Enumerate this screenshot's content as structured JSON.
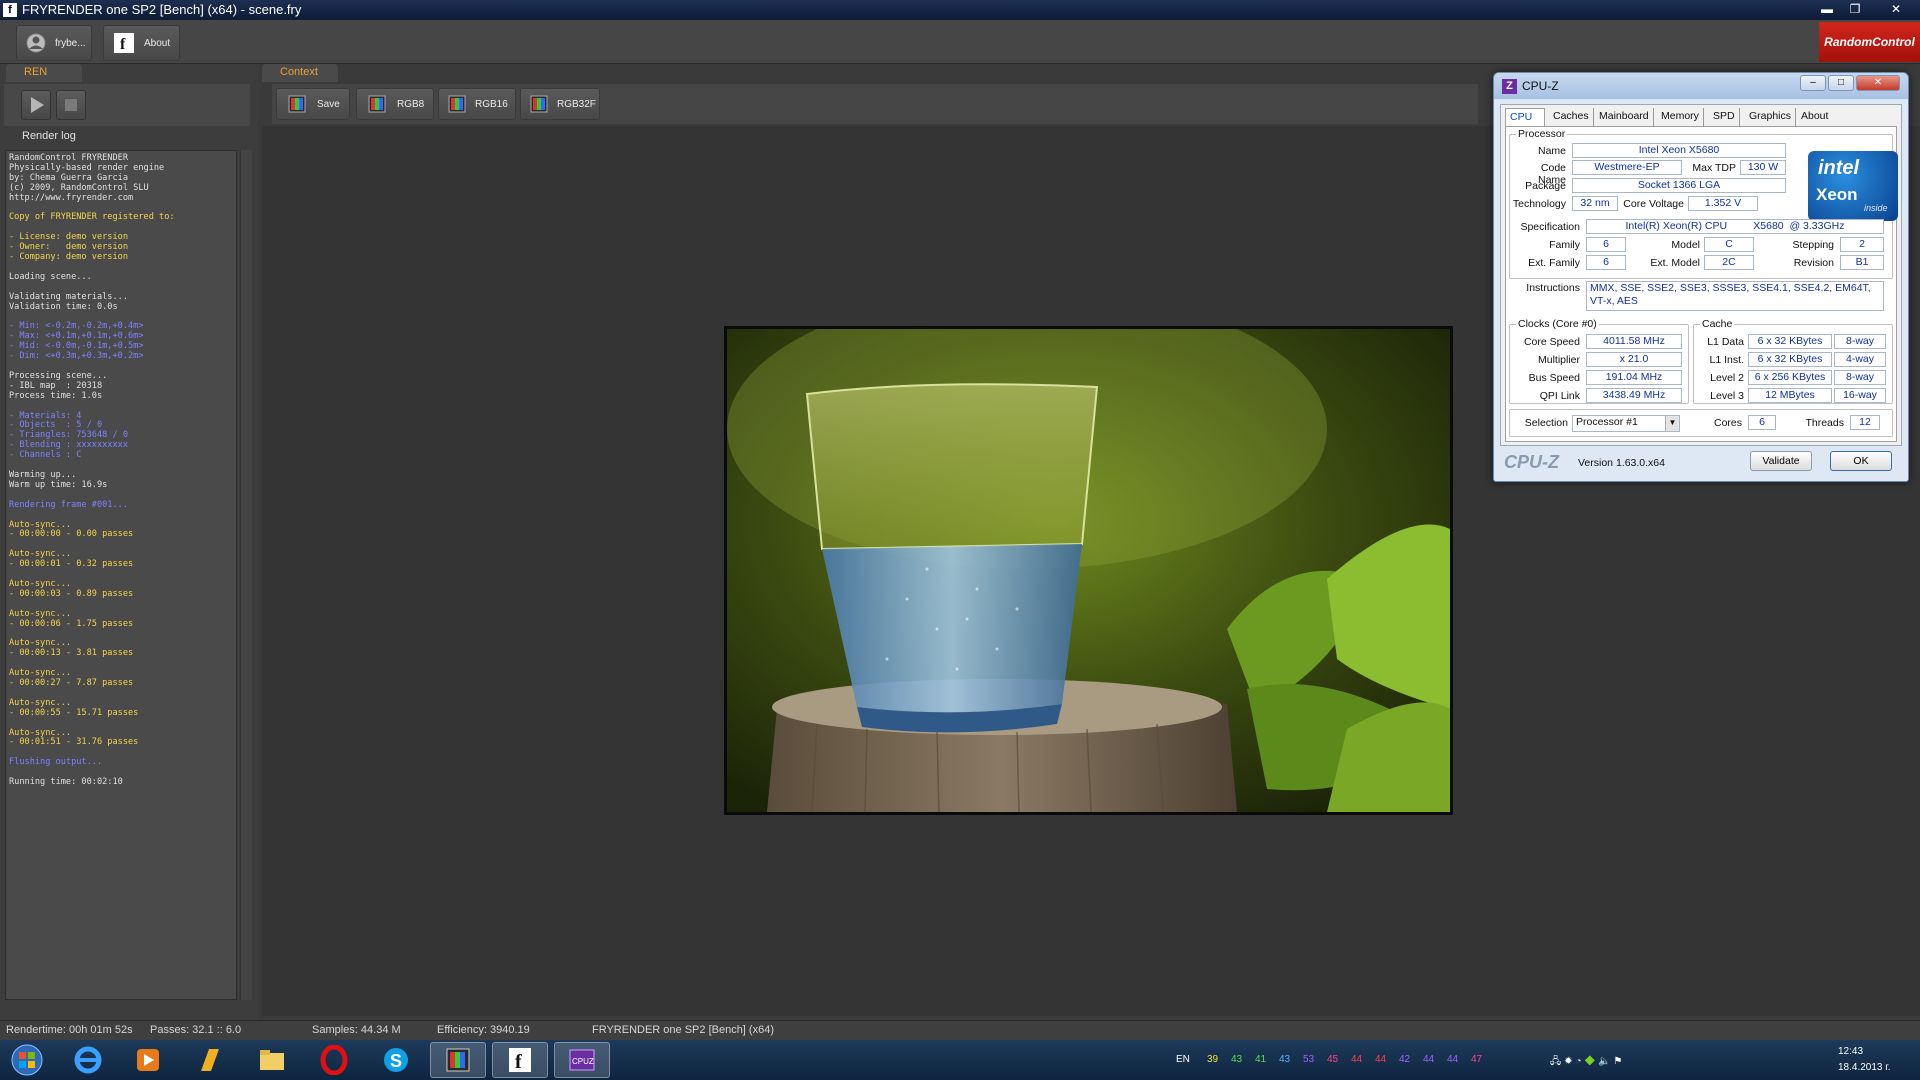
{
  "window": {
    "title": "FRYRENDER one SP2 [Bench] (x64) - scene.fry",
    "minimize": "▬",
    "maximize": "❐",
    "close": "✕"
  },
  "app_toolbar": {
    "frybe_label": "frybe...",
    "about_label": "About",
    "brand": "RandomControl"
  },
  "left_panel": {
    "tab": "REN",
    "log_title": "Render log",
    "log_lines": [
      {
        "c": "w",
        "t": "RandomControl FRYRENDER"
      },
      {
        "c": "w",
        "t": "Physically-based render engine"
      },
      {
        "c": "w",
        "t": "by: Chema Guerra Garcia"
      },
      {
        "c": "w",
        "t": "(c) 2009, RandomControl SLU"
      },
      {
        "c": "w",
        "t": "http://www.fryrender.com"
      },
      {
        "c": "w",
        "t": ""
      },
      {
        "c": "y",
        "t": "Copy of FRYRENDER registered to:"
      },
      {
        "c": "w",
        "t": ""
      },
      {
        "c": "y",
        "t": "- License: demo version"
      },
      {
        "c": "y",
        "t": "- Owner:   demo version"
      },
      {
        "c": "y",
        "t": "- Company: demo version"
      },
      {
        "c": "w",
        "t": ""
      },
      {
        "c": "w",
        "t": "Loading scene..."
      },
      {
        "c": "w",
        "t": ""
      },
      {
        "c": "w",
        "t": "Validating materials..."
      },
      {
        "c": "w",
        "t": "Validation time: 0.0s"
      },
      {
        "c": "w",
        "t": ""
      },
      {
        "c": "b",
        "t": "- Min: <-0.2m,-0.2m,+0.4m>"
      },
      {
        "c": "b",
        "t": "- Max: <+0.1m,+0.1m,+0.6m>"
      },
      {
        "c": "b",
        "t": "- Mid: <-0.0m,-0.1m,+0.5m>"
      },
      {
        "c": "b",
        "t": "- Dim: <+0.3m,+0.3m,+0.2m>"
      },
      {
        "c": "w",
        "t": ""
      },
      {
        "c": "w",
        "t": "Processing scene..."
      },
      {
        "c": "w",
        "t": "- IBL map  : 20318"
      },
      {
        "c": "w",
        "t": "Process time: 1.0s"
      },
      {
        "c": "w",
        "t": ""
      },
      {
        "c": "b",
        "t": "- Materials: 4"
      },
      {
        "c": "b",
        "t": "- Objects  : 5 / 0"
      },
      {
        "c": "b",
        "t": "- Triangles: 753648 / 0"
      },
      {
        "c": "b",
        "t": "- Blending : xxxxxxxxxx"
      },
      {
        "c": "b",
        "t": "- Channels : C"
      },
      {
        "c": "w",
        "t": ""
      },
      {
        "c": "w",
        "t": "Warming up..."
      },
      {
        "c": "w",
        "t": "Warm up time: 16.9s"
      },
      {
        "c": "w",
        "t": ""
      },
      {
        "c": "b",
        "t": "Rendering frame #001..."
      },
      {
        "c": "w",
        "t": ""
      },
      {
        "c": "y",
        "t": "Auto-sync..."
      },
      {
        "c": "y",
        "t": "- 00:00:00 - 0.00 passes"
      },
      {
        "c": "w",
        "t": ""
      },
      {
        "c": "y",
        "t": "Auto-sync..."
      },
      {
        "c": "y",
        "t": "- 00:00:01 - 0.32 passes"
      },
      {
        "c": "w",
        "t": ""
      },
      {
        "c": "y",
        "t": "Auto-sync..."
      },
      {
        "c": "y",
        "t": "- 00:00:03 - 0.89 passes"
      },
      {
        "c": "w",
        "t": ""
      },
      {
        "c": "y",
        "t": "Auto-sync..."
      },
      {
        "c": "y",
        "t": "- 00:00:06 - 1.75 passes"
      },
      {
        "c": "w",
        "t": ""
      },
      {
        "c": "y",
        "t": "Auto-sync..."
      },
      {
        "c": "y",
        "t": "- 00:00:13 - 3.81 passes"
      },
      {
        "c": "w",
        "t": ""
      },
      {
        "c": "y",
        "t": "Auto-sync..."
      },
      {
        "c": "y",
        "t": "- 00:00:27 - 7.87 passes"
      },
      {
        "c": "w",
        "t": ""
      },
      {
        "c": "y",
        "t": "Auto-sync..."
      },
      {
        "c": "y",
        "t": "- 00:00:55 - 15.71 passes"
      },
      {
        "c": "w",
        "t": ""
      },
      {
        "c": "y",
        "t": "Auto-sync..."
      },
      {
        "c": "y",
        "t": "- 00:01:51 - 31.76 passes"
      },
      {
        "c": "w",
        "t": ""
      },
      {
        "c": "b",
        "t": "Flushing output..."
      },
      {
        "c": "w",
        "t": ""
      },
      {
        "c": "w",
        "t": "Running time: 00:02:10"
      }
    ]
  },
  "context": {
    "tab": "Context",
    "buttons": [
      "Save",
      "RGB8",
      "RGB16",
      "RGB32F"
    ]
  },
  "status": {
    "rendertime": "Rendertime: 00h 01m 52s",
    "passes": "Passes: 32.1 :: 6.0",
    "samples": "Samples: 44.34 M",
    "efficiency": "Efficiency: 3940.19",
    "product": "FRYRENDER one SP2 [Bench] (x64)"
  },
  "cpuz": {
    "title": "CPU-Z",
    "tabs": [
      "CPU",
      "Caches",
      "Mainboard",
      "Memory",
      "SPD",
      "Graphics",
      "About"
    ],
    "processor_group": "Processor",
    "name_label": "Name",
    "name": "Intel Xeon X5680",
    "codename_label": "Code Name",
    "codename": "Westmere-EP",
    "maxtdp_label": "Max TDP",
    "maxtdp": "130 W",
    "package_label": "Package",
    "package": "Socket 1366 LGA",
    "technology_label": "Technology",
    "technology": "32 nm",
    "corevoltage_label": "Core Voltage",
    "corevoltage": "1.352 V",
    "spec_label": "Specification",
    "spec": "Intel(R) Xeon(R) CPU         X5680  @ 3.33GHz",
    "family_label": "Family",
    "family": "6",
    "model_label": "Model",
    "model": "C",
    "stepping_label": "Stepping",
    "stepping": "2",
    "extfamily_label": "Ext. Family",
    "extfamily": "6",
    "extmodel_label": "Ext. Model",
    "extmodel": "2C",
    "revision_label": "Revision",
    "revision": "B1",
    "instructions_label": "Instructions",
    "instructions_1": "MMX, SSE, SSE2, SSE3, SSSE3, SSE4.1, SSE4.2, EM64T,",
    "instructions_2": "VT-x, AES",
    "intel_logo": "intel",
    "xeon_logo": "Xeon",
    "inside_logo": "inside",
    "clocks_group": "Clocks (Core #0)",
    "corespeed_label": "Core Speed",
    "corespeed": "4011.58 MHz",
    "multiplier_label": "Multiplier",
    "multiplier": "x 21.0",
    "busspeed_label": "Bus Speed",
    "busspeed": "191.04 MHz",
    "qpi_label": "QPI Link",
    "qpi": "3438.49 MHz",
    "cache_group": "Cache",
    "l1d_label": "L1 Data",
    "l1d": "6 x 32 KBytes",
    "l1d_way": "8-way",
    "l1i_label": "L1 Inst.",
    "l1i": "6 x 32 KBytes",
    "l1i_way": "4-way",
    "l2_label": "Level 2",
    "l2": "6 x 256 KBytes",
    "l2_way": "8-way",
    "l3_label": "Level 3",
    "l3": "12 MBytes",
    "l3_way": "16-way",
    "selection_label": "Selection",
    "selection": "Processor #1",
    "cores_label": "Cores",
    "cores": "6",
    "threads_label": "Threads",
    "threads": "12",
    "brand": "CPU-Z",
    "version": "Version 1.63.0.x64",
    "validate": "Validate",
    "ok": "OK"
  },
  "taskbar": {
    "lang": "EN",
    "temps": [
      "39",
      "43",
      "41",
      "43",
      "53",
      "45",
      "44",
      "44",
      "42",
      "44",
      "44",
      "47"
    ],
    "temp_colors": [
      "#f0e030",
      "#50e050",
      "#50e050",
      "#50b0ff",
      "#a060ff",
      "#ff4090",
      "#ff4040",
      "#ff4040",
      "#a060ff",
      "#a060ff",
      "#a060ff",
      "#ff4090"
    ],
    "tray_39": "39",
    "time": "12:43",
    "date": "18.4.2013 г."
  }
}
